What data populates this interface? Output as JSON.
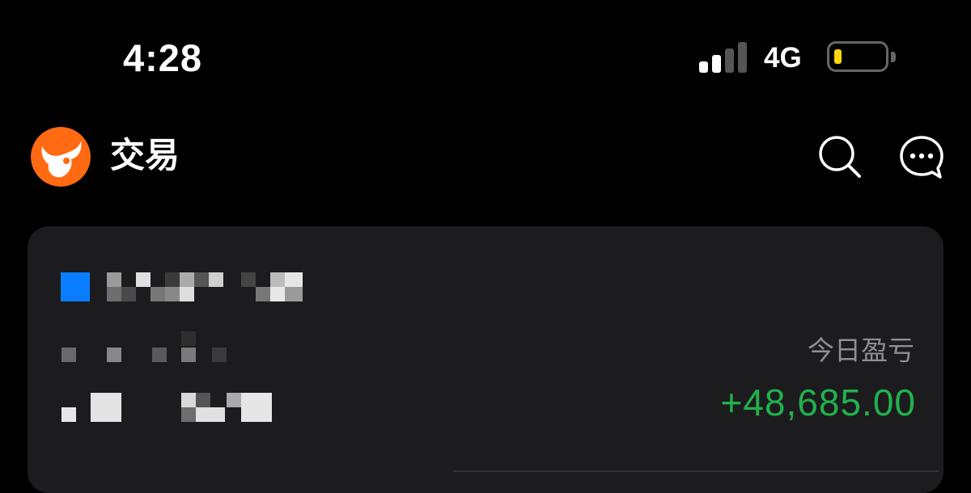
{
  "status_bar": {
    "time": "4:28",
    "network": "4G",
    "signal_bars_active": 2,
    "signal_bars_total": 4,
    "battery_color": "#ffd60a"
  },
  "header": {
    "title": "交易",
    "logo_icon": "bull-logo-icon",
    "search_icon": "search-icon",
    "message_icon": "message-icon"
  },
  "account_card": {
    "account_color": "#0a7dff",
    "pnl_label": "今日盈亏",
    "pnl_value": "+48,685.00",
    "pnl_color": "#21b14d"
  }
}
